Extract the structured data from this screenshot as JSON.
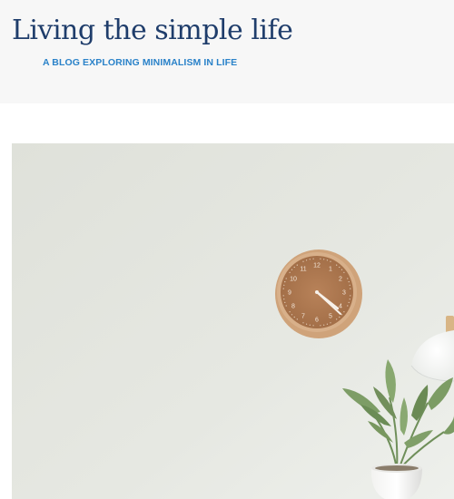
{
  "site": {
    "title": "Living the simple life",
    "tagline": "A BLOG EXPLORING MINIMALISM IN LIFE"
  },
  "hero_image": {
    "subject": "clock-on-wall-with-plant",
    "clock_numbers": [
      "12",
      "1",
      "2",
      "3",
      "4",
      "5",
      "6",
      "7",
      "8",
      "9",
      "10",
      "11"
    ]
  },
  "colors": {
    "title": "#1f3d6b",
    "tagline": "#2a82c9",
    "header_bg": "#f7f7f7",
    "wall": "#e4e6e0"
  }
}
